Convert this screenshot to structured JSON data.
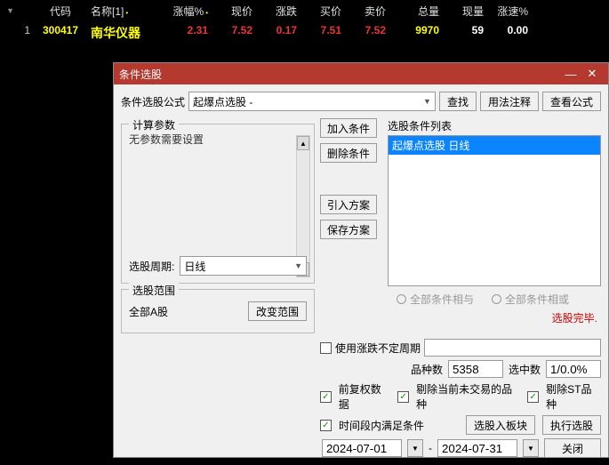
{
  "table": {
    "headers": {
      "code": "代码",
      "name": "名称[1]",
      "pct": "涨幅%",
      "price": "现价",
      "chg": "涨跌",
      "bid": "买价",
      "ask": "卖价",
      "vol": "总量",
      "cvol": "现量",
      "speed": "涨速%"
    },
    "row": {
      "idx": "1",
      "code": "300417",
      "name": "南华仪器",
      "pct": "2.31",
      "price": "7.52",
      "chg": "0.17",
      "bid": "7.51",
      "ask": "7.52",
      "vol": "9970",
      "cvol": "59",
      "speed": "0.00"
    }
  },
  "dialog": {
    "title": "条件选股",
    "formula_label": "条件选股公式",
    "formula_value": "起爆点选股   -",
    "btn_find": "查找",
    "btn_usage": "用法注释",
    "btn_view": "查看公式",
    "calc_title": "计算参数",
    "no_params": "无参数需要设置",
    "period_label": "选股周期:",
    "period_value": "日线",
    "btn_add": "加入条件",
    "btn_del": "删除条件",
    "btn_import": "引入方案",
    "btn_save": "保存方案",
    "cond_list_label": "选股条件列表",
    "cond_item": "起爆点选股  日线",
    "radio_and": "全部条件相与",
    "radio_or": "全部条件相或",
    "range_title": "选股范围",
    "range_value": "全部A股",
    "btn_change_range": "改变范围",
    "status": "选股完毕.",
    "chk_unfixed": "使用涨跌不定周期",
    "count_kind_label": "品种数",
    "count_kind": "5358",
    "count_sel_label": "选中数",
    "count_sel": "1/0.0%",
    "chk_fq": "前复权数据",
    "chk_notrade": "剔除当前未交易的品种",
    "chk_st": "剔除ST品种",
    "chk_timerange": "时间段内满足条件",
    "btn_toblock": "选股入板块",
    "btn_run": "执行选股",
    "date_from": "2024-07-01",
    "date_to": "2024-07-31",
    "date_sep": "-",
    "btn_close": "关闭"
  }
}
